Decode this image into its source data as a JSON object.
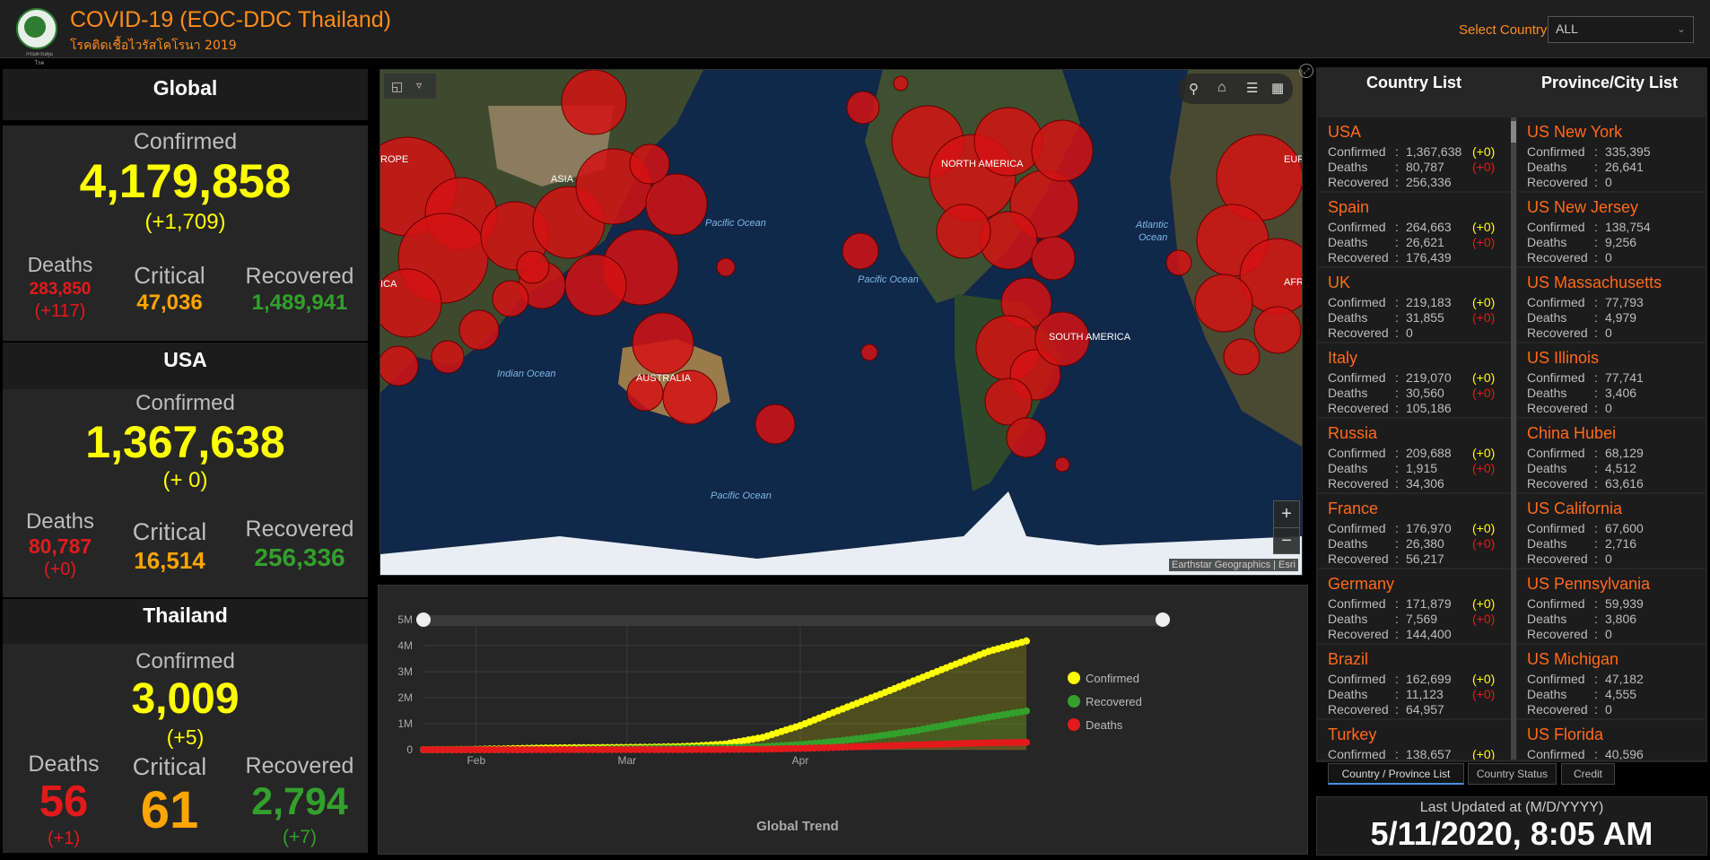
{
  "header": {
    "title": "COVID-19 (EOC-DDC Thailand)",
    "subtitle": "โรคติดเชื้อไวรัสโคโรนา 2019",
    "logo_caption": "กรมควบคุมโรค",
    "select_label": "Select Country",
    "select_value": "ALL"
  },
  "global": {
    "title": "Global",
    "confirmed_label": "Confirmed",
    "confirmed": "4,179,858",
    "confirmed_delta": "(+1,709)",
    "deaths_label": "Deaths",
    "deaths": "283,850",
    "deaths_delta": "(+117)",
    "critical_label": "Critical",
    "critical": "47,036",
    "recovered_label": "Recovered",
    "recovered": "1,489,941"
  },
  "usa": {
    "title": "USA",
    "confirmed_label": "Confirmed",
    "confirmed": "1,367,638",
    "confirmed_delta": "(+ 0)",
    "deaths_label": "Deaths",
    "deaths": "80,787",
    "deaths_delta": "(+0)",
    "critical_label": "Critical",
    "critical": "16,514",
    "recovered_label": "Recovered",
    "recovered": "256,336"
  },
  "thailand": {
    "title": "Thailand",
    "confirmed_label": "Confirmed",
    "confirmed": "3,009",
    "confirmed_delta": "(+5)",
    "deaths_label": "Deaths",
    "deaths": "56",
    "deaths_delta": "(+1)",
    "critical_label": "Critical",
    "critical": "61",
    "recovered_label": "Recovered",
    "recovered": "2,794",
    "recovered_delta": "(+7)"
  },
  "map": {
    "labels": {
      "asia": "ASIA",
      "north_america": "NORTH AMERICA",
      "south_america": "SOUTH AMERICA",
      "australia": "AUSTRALIA",
      "europe_frag": "ROPE",
      "africa_frag": "ICA",
      "europe_frag_right": "EUR",
      "africa_frag_right": "AFR",
      "pacific_1": "Pacific Ocean",
      "pacific_2": "Pacific Ocean",
      "pacific_3": "Pacific Ocean",
      "indian": "Indian Ocean",
      "atlantic_1": "Atlantic",
      "atlantic_2": "Ocean"
    },
    "attribution": "Earthstar Geographics | Esri",
    "zoom_in": "+",
    "zoom_out": "−"
  },
  "chart_data": {
    "type": "line",
    "title": "",
    "xlabel": "Global Trend",
    "ylabel": "",
    "x_ticks": [
      "Feb",
      "Mar",
      "Apr"
    ],
    "y_ticks": [
      "0",
      "1M",
      "2M",
      "3M",
      "4M",
      "5M"
    ],
    "ylim": [
      0,
      5000000
    ],
    "x": [
      "1/22",
      "1/29",
      "2/5",
      "2/12",
      "2/19",
      "2/26",
      "3/4",
      "3/11",
      "3/18",
      "3/25",
      "4/1",
      "4/8",
      "4/15",
      "4/22",
      "4/29",
      "5/6",
      "5/11"
    ],
    "series": [
      {
        "name": "Confirmed",
        "color": "#ffff00",
        "values": [
          600,
          6000,
          28000,
          60000,
          76000,
          83000,
          95000,
          126000,
          215000,
          470000,
          930000,
          1500000,
          2060000,
          2640000,
          3220000,
          3780000,
          4179858
        ]
      },
      {
        "name": "Recovered",
        "color": "#33a02c",
        "values": [
          30,
          130,
          1100,
          6800,
          18000,
          33000,
          51000,
          68000,
          84000,
          115000,
          195000,
          330000,
          510000,
          720000,
          985000,
          1250000,
          1489941
        ]
      },
      {
        "name": "Deaths",
        "color": "#e31a1c",
        "values": [
          17,
          130,
          560,
          1400,
          2200,
          2800,
          3300,
          4600,
          9000,
          22000,
          47000,
          88000,
          138000,
          185000,
          228000,
          264000,
          283850
        ]
      }
    ],
    "legend_position": "right",
    "grid": true
  },
  "country_list": {
    "title": "Country List",
    "confirmed_label": "Confirmed",
    "deaths_label": "Deaths",
    "recovered_label": "Recovered",
    "sep": ":",
    "items": [
      {
        "name": "USA",
        "confirmed": "1,367,638",
        "confirmed_delta": "(+0)",
        "deaths": "80,787",
        "deaths_delta": "(+0)",
        "recovered": "256,336"
      },
      {
        "name": "Spain",
        "confirmed": "264,663",
        "confirmed_delta": "(+0)",
        "deaths": "26,621",
        "deaths_delta": "(+0)",
        "recovered": "176,439"
      },
      {
        "name": "UK",
        "confirmed": "219,183",
        "confirmed_delta": "(+0)",
        "deaths": "31,855",
        "deaths_delta": "(+0)",
        "recovered": "0"
      },
      {
        "name": "Italy",
        "confirmed": "219,070",
        "confirmed_delta": "(+0)",
        "deaths": "30,560",
        "deaths_delta": "(+0)",
        "recovered": "105,186"
      },
      {
        "name": "Russia",
        "confirmed": "209,688",
        "confirmed_delta": "(+0)",
        "deaths": "1,915",
        "deaths_delta": "(+0)",
        "recovered": "34,306"
      },
      {
        "name": "France",
        "confirmed": "176,970",
        "confirmed_delta": "(+0)",
        "deaths": "26,380",
        "deaths_delta": "(+0)",
        "recovered": "56,217"
      },
      {
        "name": "Germany",
        "confirmed": "171,879",
        "confirmed_delta": "(+0)",
        "deaths": "7,569",
        "deaths_delta": "(+0)",
        "recovered": "144,400"
      },
      {
        "name": "Brazil",
        "confirmed": "162,699",
        "confirmed_delta": "(+0)",
        "deaths": "11,123",
        "deaths_delta": "(+0)",
        "recovered": "64,957"
      },
      {
        "name": "Turkey",
        "confirmed": "138,657",
        "confirmed_delta": "(+0)",
        "deaths": "",
        "deaths_delta": "",
        "recovered": ""
      }
    ]
  },
  "province_list": {
    "title": "Province/City List",
    "items": [
      {
        "country": "US",
        "name": "New York",
        "confirmed": "335,395",
        "deaths": "26,641",
        "recovered": "0"
      },
      {
        "country": "US",
        "name": "New Jersey",
        "confirmed": "138,754",
        "deaths": "9,256",
        "recovered": "0"
      },
      {
        "country": "US",
        "name": "Massachusetts",
        "confirmed": "77,793",
        "deaths": "4,979",
        "recovered": "0"
      },
      {
        "country": "US",
        "name": "Illinois",
        "confirmed": "77,741",
        "deaths": "3,406",
        "recovered": "0"
      },
      {
        "country": "China",
        "name": "Hubei",
        "confirmed": "68,129",
        "deaths": "4,512",
        "recovered": "63,616"
      },
      {
        "country": "US",
        "name": "California",
        "confirmed": "67,600",
        "deaths": "2,716",
        "recovered": "0"
      },
      {
        "country": "US",
        "name": "Pennsylvania",
        "confirmed": "59,939",
        "deaths": "3,806",
        "recovered": "0"
      },
      {
        "country": "US",
        "name": "Michigan",
        "confirmed": "47,182",
        "deaths": "4,555",
        "recovered": "0"
      },
      {
        "country": "US",
        "name": "Florida",
        "confirmed": "40,596",
        "deaths": "",
        "recovered": ""
      }
    ]
  },
  "tabs": {
    "country_province": "Country / Province List",
    "country_status": "Country Status",
    "credit": "Credit"
  },
  "last_updated": {
    "label": "Last Updated at (M/D/YYYY)",
    "value": "5/11/2020, 8:05 AM"
  }
}
